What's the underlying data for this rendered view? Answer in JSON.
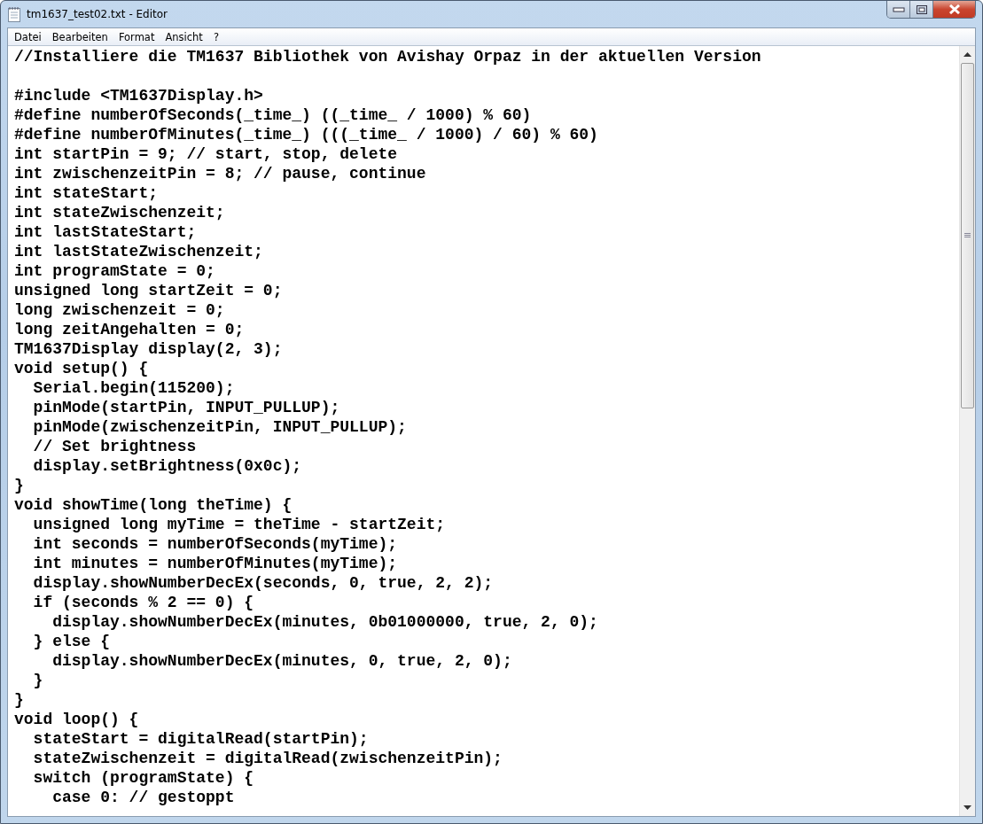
{
  "window": {
    "title": "tm1637_test02.txt - Editor"
  },
  "menu": [
    "Datei",
    "Bearbeiten",
    "Format",
    "Ansicht",
    "?"
  ],
  "editor": {
    "paragraphs": [
      [
        "//Installiere die TM1637 Bibliothek von Avishay Orpaz in der aktuellen Version"
      ],
      [
        "#include <TM1637Display.h>",
        "#define numberOfSeconds(_time_) ((_time_ / 1000) % 60)",
        "#define numberOfMinutes(_time_) (((_time_ / 1000) / 60) % 60)",
        "int startPin = 9; // start, stop, delete",
        "int zwischenzeitPin = 8; // pause, continue",
        "int stateStart;",
        "int stateZwischenzeit;",
        "int lastStateStart;",
        "int lastStateZwischenzeit;",
        "int programState = 0;",
        "unsigned long startZeit = 0;",
        "long zwischenzeit = 0;",
        "long zeitAngehalten = 0;",
        "TM1637Display display(2, 3);",
        "void setup() {",
        "  Serial.begin(115200);",
        "  pinMode(startPin, INPUT_PULLUP);",
        "  pinMode(zwischenzeitPin, INPUT_PULLUP);",
        "  // Set brightness",
        "  display.setBrightness(0x0c);",
        "}",
        "void showTime(long theTime) {",
        "  unsigned long myTime = theTime - startZeit;",
        "  int seconds = numberOfSeconds(myTime);",
        "  int minutes = numberOfMinutes(myTime);",
        "  display.showNumberDecEx(seconds, 0, true, 2, 2);",
        "  if (seconds % 2 == 0) {",
        "    display.showNumberDecEx(minutes, 0b01000000, true, 2, 0);",
        "  } else {",
        "    display.showNumberDecEx(minutes, 0, true, 2, 0);",
        "  }",
        "}",
        "void loop() {",
        "  stateStart = digitalRead(startPin);",
        "  stateZwischenzeit = digitalRead(zwischenzeitPin);",
        "  switch (programState) {",
        "    case 0: // gestoppt"
      ]
    ]
  }
}
